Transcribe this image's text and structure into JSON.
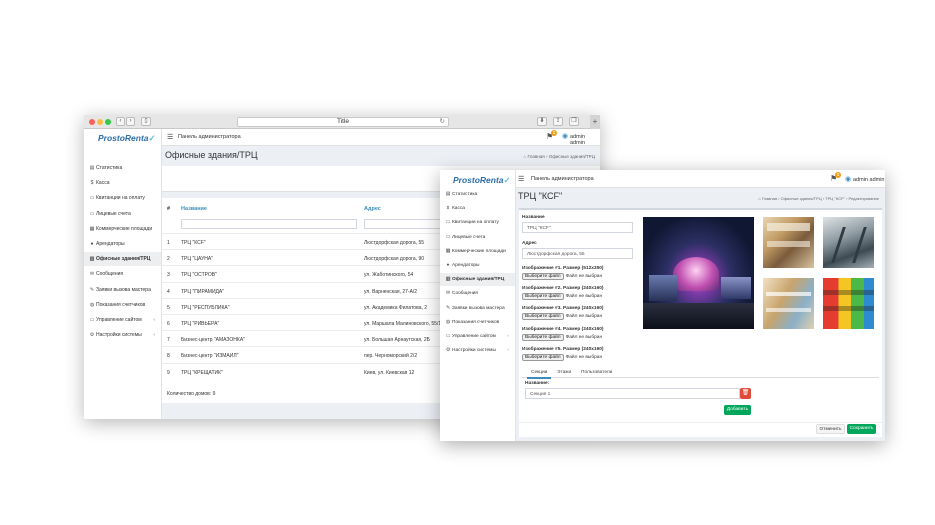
{
  "window1": {
    "title": "Title",
    "logo": {
      "main": "ProstoRenta",
      "mark": "✓"
    },
    "topbar": {
      "title": "Панель администратора",
      "notifications": "1",
      "user": "admin admin"
    },
    "sidebar": [
      {
        "label": "Статистика",
        "icon": "chart-icon"
      },
      {
        "label": "Касса",
        "icon": "dollar-icon"
      },
      {
        "label": "Квитанции на оплату",
        "icon": "receipt-icon"
      },
      {
        "label": "Лицевые счета",
        "icon": "accounts-icon"
      },
      {
        "label": "Коммерческие площади",
        "icon": "grid-icon"
      },
      {
        "label": "Арендаторы",
        "icon": "users-icon"
      },
      {
        "label": "Офисные здания/ТРЦ",
        "icon": "building-icon",
        "active": true
      },
      {
        "label": "Сообщения",
        "icon": "envelope-icon"
      },
      {
        "label": "Заявки вызова мастера",
        "icon": "wrench-icon"
      },
      {
        "label": "Показания счетчиков",
        "icon": "meter-icon"
      },
      {
        "label": "Управление сайтом",
        "icon": "monitor-icon",
        "arrow": "‹"
      },
      {
        "label": "Настройки системы",
        "icon": "settings-icon",
        "arrow": "‹"
      }
    ],
    "page_title": "Офисные здания/ТРЦ",
    "breadcrumb": {
      "home": "Главная",
      "current": "Офисные здания/ТРЦ"
    },
    "table": {
      "headers": [
        "#",
        "Название",
        "Адрес"
      ],
      "rows": [
        [
          "1",
          "ТРЦ \"КСF\"",
          "Люстдорфская дорога, 55"
        ],
        [
          "2",
          "ТРЦ \"ЦАУНА\"",
          "Люстдорфская дорога, 90"
        ],
        [
          "3",
          "ТРЦ \"ОСТРОВ\"",
          "ул. Жаботинского, 54"
        ],
        [
          "4",
          "ТРЦ \"ПИРАМИДА\"",
          "ул. Варненская, 27-А/2"
        ],
        [
          "5",
          "ТРЦ \"РЕСПУБЛИКА\"",
          "ул. Академика Филатова, 2"
        ],
        [
          "6",
          "ТРЦ \"РИВЬЕРА\"",
          "ул. Маршала Малиновского, 55/1"
        ],
        [
          "7",
          "Бизнес-центр \"АМАЗОНКА\"",
          "ул. Большая Арнаутская, 2Б"
        ],
        [
          "8",
          "Бизнес-центр \"ИЗМАИЛ\"",
          "пер. Черноморский 2/2"
        ],
        [
          "9",
          "ТРЦ \"КРЕЩАТИК\"",
          "Киев, ул. Киевская 12"
        ]
      ],
      "footer": "Количество домов: 9"
    }
  },
  "window2": {
    "logo": {
      "main": "ProstoRenta",
      "mark": "✓"
    },
    "topbar": {
      "title": "Панель администратора",
      "notifications": "1",
      "user": "admin admin"
    },
    "sidebar": [
      {
        "label": "Статистика",
        "icon": "chart-icon"
      },
      {
        "label": "Касса",
        "icon": "dollar-icon"
      },
      {
        "label": "Квитанции на оплату",
        "icon": "receipt-icon"
      },
      {
        "label": "Лицевые счета",
        "icon": "accounts-icon"
      },
      {
        "label": "Коммерческие площади",
        "icon": "grid-icon"
      },
      {
        "label": "Арендаторы",
        "icon": "users-icon"
      },
      {
        "label": "Офисные здания/ТРЦ",
        "icon": "building-icon",
        "active": true
      },
      {
        "label": "Сообщения",
        "icon": "envelope-icon"
      },
      {
        "label": "Заявки вызова мастера",
        "icon": "wrench-icon"
      },
      {
        "label": "Показания счетчиков",
        "icon": "meter-icon"
      },
      {
        "label": "Управление сайтом",
        "icon": "monitor-icon",
        "arrow": "‹"
      },
      {
        "label": "Настройки системы",
        "icon": "settings-icon",
        "arrow": "‹"
      }
    ],
    "page_title": "ТРЦ \"КСF\"",
    "breadcrumb": {
      "home": "Главная",
      "section": "Офисные здания/ТРЦ",
      "item": "ТРЦ \"КСF\"",
      "current": "Редактирование"
    },
    "form": {
      "name_label": "Название",
      "name_value": "ТРЦ \"КСF\"",
      "address_label": "Адрес",
      "address_value": "Люстдорфская дорога, 55",
      "images": [
        {
          "label": "Изображение #1. Размер (512x350)"
        },
        {
          "label": "Изображение #2. Размер (240x160)"
        },
        {
          "label": "Изображение #3. Размер (240x160)"
        },
        {
          "label": "Изображение #4. Размер (240x160)"
        },
        {
          "label": "Изображение #5. Размер (240x160)"
        }
      ],
      "choose_file": "Выберите файл",
      "no_file": "Файл не выбран"
    },
    "tabs": [
      "Секции",
      "Этажи",
      "Пользователи"
    ],
    "section": {
      "label": "Название:",
      "value": "Секция 1",
      "delete_icon": "trash-icon"
    },
    "buttons": {
      "add": "Добавить",
      "cancel": "Отменить",
      "save": "Сохранить"
    },
    "colors": {
      "accent_green": "#00a65a",
      "delete_red": "#dd4b39",
      "brand_blue": "#2d6ea8"
    }
  }
}
